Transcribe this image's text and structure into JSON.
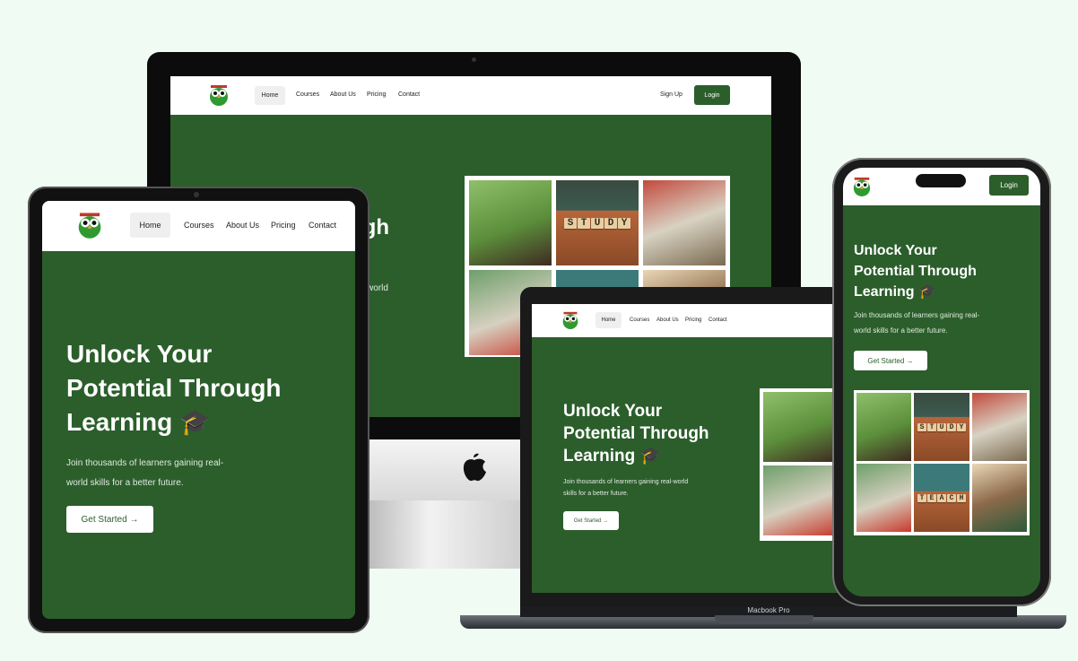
{
  "site": {
    "nav": [
      "Home",
      "Courses",
      "About Us",
      "Pricing",
      "Contact"
    ],
    "signup": "Sign Up",
    "login": "Login",
    "hero_title_1": "Unlock Your",
    "hero_title_2": "Potential Through",
    "hero_title_3": "Learning 🎓",
    "hero_sub_1": "Join thousands of learners gaining real-",
    "hero_sub_2": "world skills for a better future.",
    "hero_sub_full_1": "Join thousands of learners gaining real-world",
    "hero_sub_full_2": "skills for a better future.",
    "cta": "Get Started →",
    "desktop_partial_title": "ugh",
    "desktop_partial_sub": "world",
    "tile_study": [
      "S",
      "T",
      "U",
      "D",
      "Y"
    ],
    "tile_teach": [
      "T",
      "E",
      "A",
      "C",
      "H"
    ]
  },
  "devices": {
    "laptop_label": "Macbook Pro"
  },
  "colors": {
    "brand_green": "#2b5e2b",
    "background": "#f0fbf3"
  }
}
